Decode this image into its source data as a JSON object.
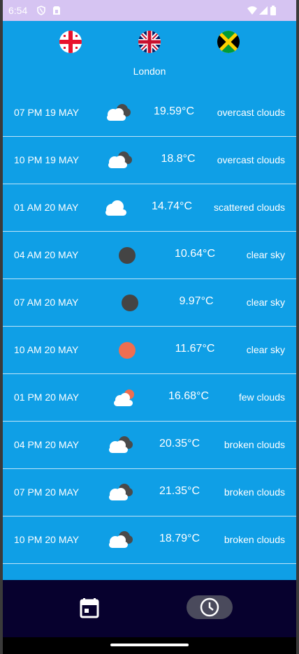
{
  "status_bar": {
    "time": "6:54",
    "icons": [
      "shield-icon",
      "sim-card-icon",
      "wifi-icon",
      "signal-icon",
      "battery-icon"
    ]
  },
  "flags": [
    {
      "name": "georgia-flag-icon"
    },
    {
      "name": "uk-flag-icon"
    },
    {
      "name": "jamaica-flag-icon"
    }
  ],
  "city": "London",
  "forecast": [
    {
      "time": "07 PM 19 MAY",
      "temp": "19.59°C",
      "desc": "overcast clouds",
      "icon": "overcast-clouds-icon"
    },
    {
      "time": "10 PM 19 MAY",
      "temp": "18.8°C",
      "desc": "overcast clouds",
      "icon": "overcast-clouds-icon"
    },
    {
      "time": "01 AM 20 MAY",
      "temp": "14.74°C",
      "desc": "scattered clouds",
      "icon": "scattered-clouds-icon"
    },
    {
      "time": "04 AM 20 MAY",
      "temp": "10.64°C",
      "desc": "clear sky",
      "icon": "moon-icon"
    },
    {
      "time": "07 AM 20 MAY",
      "temp": "9.97°C",
      "desc": "clear sky",
      "icon": "moon-icon"
    },
    {
      "time": "10 AM 20 MAY",
      "temp": "11.67°C",
      "desc": "clear sky",
      "icon": "sun-icon"
    },
    {
      "time": "01 PM 20 MAY",
      "temp": "16.68°C",
      "desc": "few clouds",
      "icon": "few-clouds-icon"
    },
    {
      "time": "04 PM 20 MAY",
      "temp": "20.35°C",
      "desc": "broken clouds",
      "icon": "broken-clouds-icon"
    },
    {
      "time": "07 PM 20 MAY",
      "temp": "21.35°C",
      "desc": "broken clouds",
      "icon": "broken-clouds-icon"
    },
    {
      "time": "10 PM 20 MAY",
      "temp": "18.79°C",
      "desc": "broken clouds",
      "icon": "broken-clouds-icon"
    }
  ],
  "bottom_nav": {
    "items": [
      {
        "icon": "calendar-icon",
        "selected": false
      },
      {
        "icon": "clock-icon",
        "selected": true
      }
    ]
  },
  "colors": {
    "background": "#0f9fe6",
    "status_bar": "#d6c4f2",
    "nav_bar": "#07012e",
    "moon": "#444444",
    "sun": "#ee6e50"
  }
}
